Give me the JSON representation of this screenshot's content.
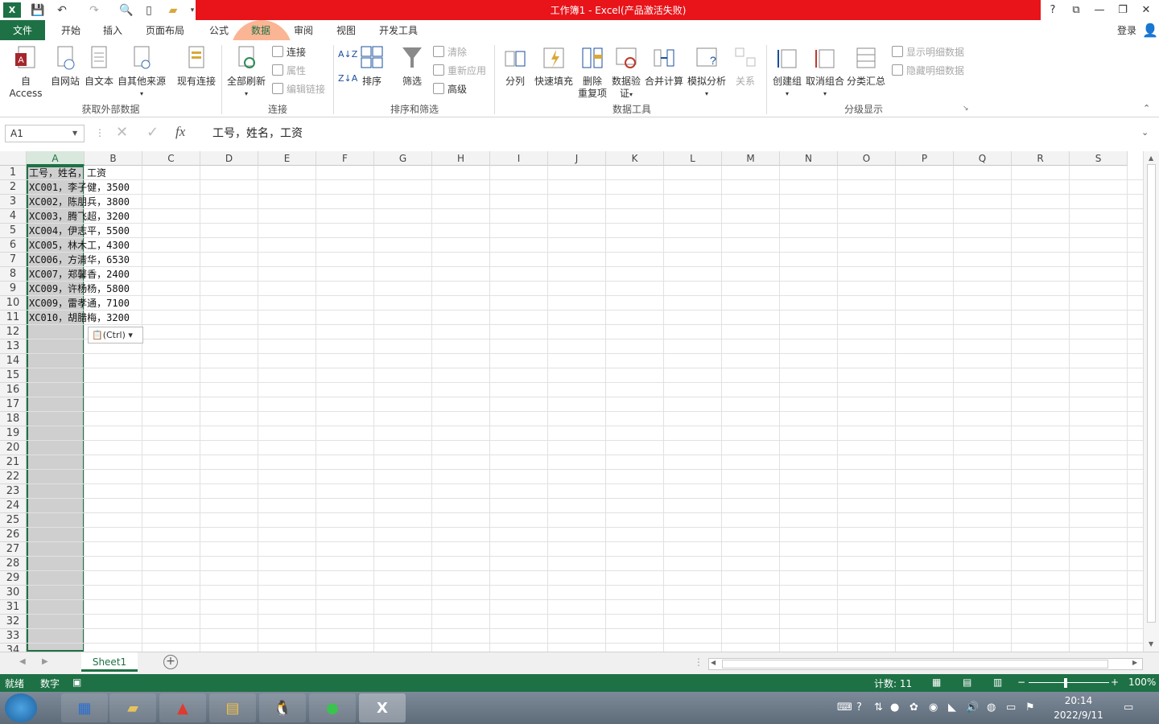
{
  "titlebar": {
    "title": "工作簿1 - Excel(产品激活失败)",
    "help": "?",
    "restore_ribbon": "⧉",
    "minimize": "—",
    "maximize": "❐",
    "close": "✕"
  },
  "tabs": {
    "file": "文件",
    "home": "开始",
    "insert": "插入",
    "layout": "页面布局",
    "formulas": "公式",
    "data": "数据",
    "review": "审阅",
    "view": "视图",
    "developer": "开发工具",
    "login": "登录"
  },
  "ribbon": {
    "from_access": "自 Access",
    "from_web": "自网站",
    "from_text": "自文本",
    "from_other": "自其他来源",
    "existing": "现有连接",
    "group_external": "获取外部数据",
    "refresh_all": "全部刷新",
    "connections": "连接",
    "properties": "属性",
    "edit_links": "编辑链接",
    "group_connections": "连接",
    "sort": "排序",
    "filter": "筛选",
    "clear": "清除",
    "reapply": "重新应用",
    "advanced": "高级",
    "group_sort": "排序和筛选",
    "text_to_cols": "分列",
    "flash_fill": "快速填充",
    "remove_dup_1": "删除",
    "remove_dup_2": "重复项",
    "validation_1": "数据验",
    "validation_2": "证",
    "consolidate": "合并计算",
    "what_if": "模拟分析",
    "relations": "关系",
    "group_tools": "数据工具",
    "group": "创建组",
    "ungroup": "取消组合",
    "subtotal": "分类汇总",
    "show_detail": "显示明细数据",
    "hide_detail": "隐藏明细数据",
    "group_outline": "分级显示"
  },
  "formulabar": {
    "namebox": "A1",
    "fx": "fx",
    "content": "工号，姓名，工资"
  },
  "columns": [
    "A",
    "B",
    "C",
    "D",
    "E",
    "F",
    "G",
    "H",
    "I",
    "J",
    "K",
    "L",
    "M",
    "N",
    "O",
    "P",
    "Q",
    "R",
    "S"
  ],
  "rows": [
    "1",
    "2",
    "3",
    "4",
    "5",
    "6",
    "7",
    "8",
    "9",
    "10",
    "11",
    "12",
    "13",
    "14",
    "15",
    "16",
    "17",
    "18",
    "19",
    "20",
    "21",
    "22",
    "23",
    "24",
    "25",
    "26",
    "27",
    "28",
    "29",
    "30",
    "31",
    "32",
    "33",
    "34"
  ],
  "cells": [
    "工号，姓名，工资",
    "XC001，李子健，3500",
    "XC002，陈朋兵，3800",
    "XC003，腾飞超，3200",
    "XC004，伊志平，5500",
    "XC005，林木工，4300",
    "XC006，方清华，6530",
    "XC007，郑馨香，2400",
    "XC009，许杨杨，5800",
    "XC009，雷孝通，7100",
    "XC010，胡腊梅，3200"
  ],
  "paste_options": "(Ctrl)",
  "sheet": {
    "name": "Sheet1"
  },
  "status": {
    "ready": "就绪",
    "numlock": "数字",
    "count": "计数: 11",
    "zoom": "100%"
  },
  "clock": {
    "time": "20:14",
    "date": "2022/9/11"
  },
  "colors": {
    "excel_green": "#1e7145",
    "title_red": "#e8141a"
  }
}
